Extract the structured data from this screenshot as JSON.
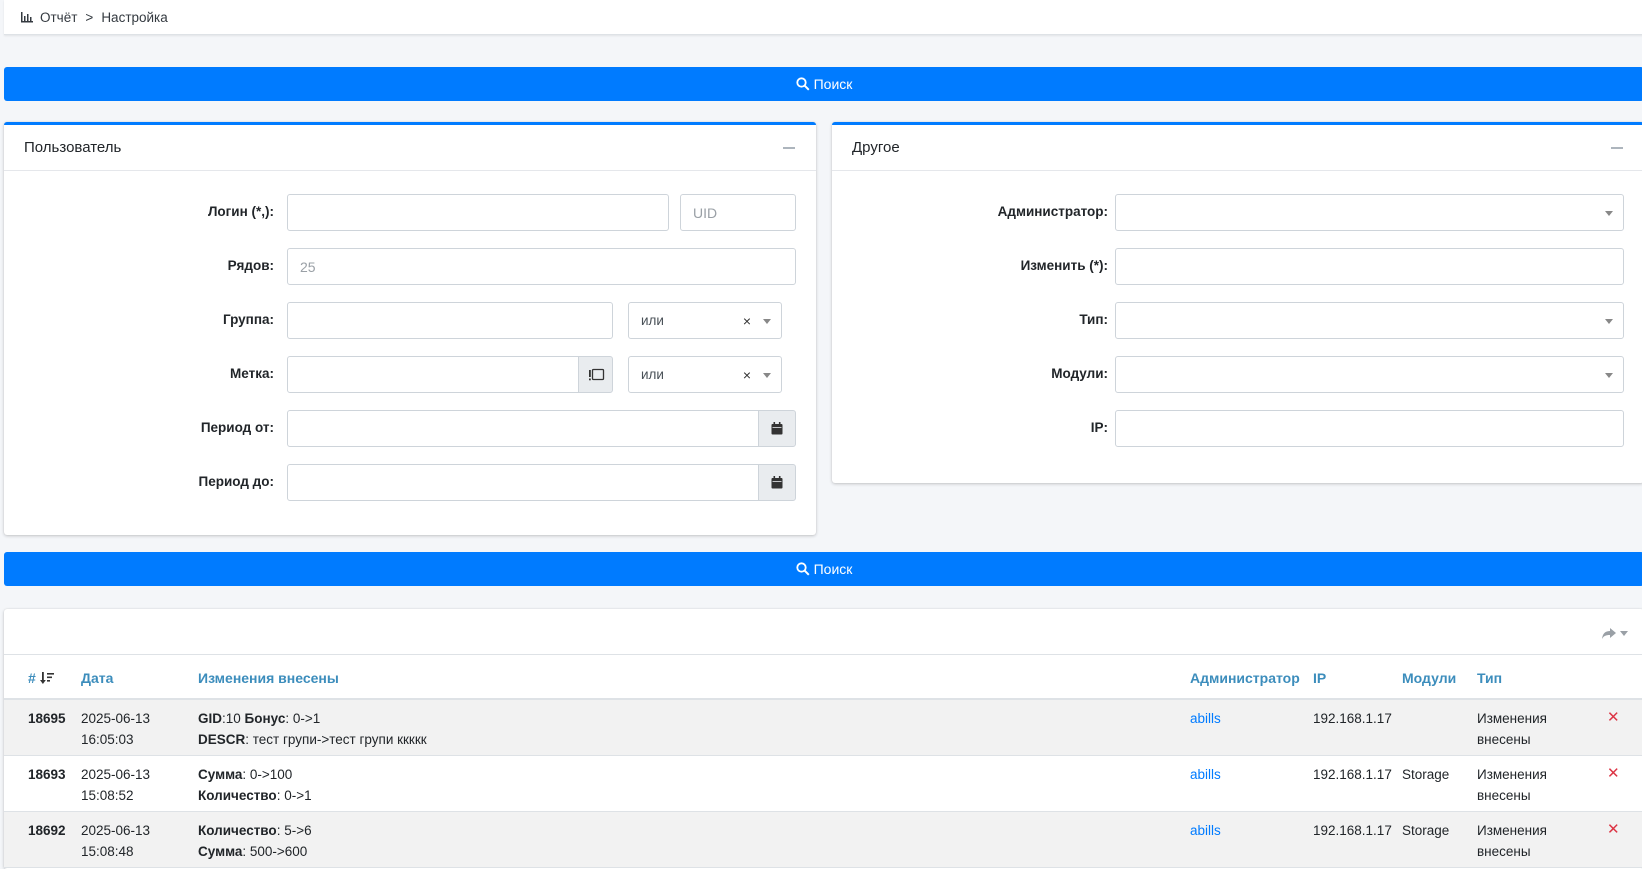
{
  "breadcrumb": {
    "root": "Отчёт",
    "separator": ">",
    "current": "Настройка"
  },
  "search_button": {
    "label": "Поиск"
  },
  "user_panel": {
    "title": "Пользователь",
    "fields": {
      "login_label": "Логин (*,):",
      "login_value": "",
      "uid_placeholder": "UID",
      "rows_label": "Рядов:",
      "rows_placeholder": "25",
      "group_label": "Группа:",
      "group_logic": "или",
      "tag_label": "Метка:",
      "tag_logic": "или",
      "period_from_label": "Период от:",
      "period_to_label": "Период до:"
    }
  },
  "other_panel": {
    "title": "Другое",
    "fields": {
      "admin_label": "Администратор:",
      "change_label": "Изменить (*):",
      "type_label": "Тип:",
      "modules_label": "Модули:",
      "ip_label": "IP:"
    }
  },
  "table": {
    "columns": {
      "id": "#",
      "date": "Дата",
      "changes": "Изменения внесены",
      "admin": "Администратор",
      "ip": "IP",
      "modules": "Модули",
      "type": "Тип"
    },
    "rows": [
      {
        "id": "18695",
        "date": "2025-06-13",
        "time": "16:05:03",
        "l1k1": "GID",
        "l1v1": ":10 ",
        "l1k2": "Бонус",
        "l1v2": ": 0->1",
        "l2k1": "DESCR",
        "l2v1": ": тест групи->тест групи ккккк",
        "admin": "abills",
        "ip": "192.168.1.17",
        "modules": "",
        "type1": "Изменения",
        "type2": "внесены"
      },
      {
        "id": "18693",
        "date": "2025-06-13",
        "time": "15:08:52",
        "l1k1": "Сумма",
        "l1v1": ": 0->100",
        "l1k2": "",
        "l1v2": "",
        "l2k1": "Количество",
        "l2v1": ": 0->1",
        "admin": "abills",
        "ip": "192.168.1.17",
        "modules": "Storage",
        "type1": "Изменения",
        "type2": "внесены"
      },
      {
        "id": "18692",
        "date": "2025-06-13",
        "time": "15:08:48",
        "l1k1": "Количество",
        "l1v1": ": 5->6",
        "l1k2": "",
        "l1v2": "",
        "l2k1": "Сумма",
        "l2v1": ": 500->600",
        "admin": "abills",
        "ip": "192.168.1.17",
        "modules": "Storage",
        "type1": "Изменения",
        "type2": "внесены"
      }
    ]
  },
  "colors": {
    "primary": "#007bff",
    "link": "#3c8dbc",
    "danger": "#dc3545"
  },
  "icons": {
    "breadcrumb": "bar-chart-icon",
    "search": "search-icon",
    "calendar": "calendar-icon",
    "tag": "tag-icon",
    "share": "share-icon",
    "sort": "sort-desc-icon",
    "delete": "close-icon"
  }
}
